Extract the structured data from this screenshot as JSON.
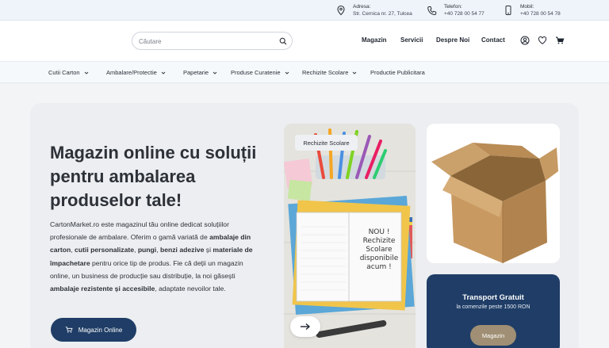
{
  "contact": [
    {
      "label": "Adresa:",
      "value": "Str. Cernica nr. 27, Tulcea",
      "icon": "location-pin-icon"
    },
    {
      "label": "Telefon:",
      "value": "+40 728 00 54 77",
      "icon": "phone-icon"
    },
    {
      "label": "Mobil:",
      "value": "+40 728 00 54 78",
      "icon": "mobile-icon"
    }
  ],
  "search": {
    "placeholder": "Căutare"
  },
  "nav": [
    "Magazin",
    "Servicii",
    "Despre Noi",
    "Contact"
  ],
  "header_icons": [
    "user-icon",
    "heart-icon",
    "cart-icon"
  ],
  "categories": [
    {
      "label": "Cutii Carton",
      "dropdown": true
    },
    {
      "label": "Ambalare/Protectie",
      "dropdown": true
    },
    {
      "label": "Papetarie",
      "dropdown": true
    },
    {
      "label": "Produse Curatenie",
      "dropdown": true
    },
    {
      "label": "Rechizite Scolare",
      "dropdown": true
    },
    {
      "label": "Productie Publicitara",
      "dropdown": false
    }
  ],
  "hero": {
    "title": "Magazin online cu soluții pentru ambalarea produselor tale!",
    "description": [
      {
        "t": "CartonMarket.ro este magazinul tău online dedicat soluțiilor profesionale de ambalare. Oferim o gamă variată de ",
        "b": false
      },
      {
        "t": "ambalaje din carton",
        "b": true
      },
      {
        "t": ", ",
        "b": false
      },
      {
        "t": "cutii personalizate",
        "b": true
      },
      {
        "t": ", ",
        "b": false
      },
      {
        "t": "pungi",
        "b": true
      },
      {
        "t": ", ",
        "b": false
      },
      {
        "t": "benzi adezive",
        "b": true
      },
      {
        "t": " și ",
        "b": false
      },
      {
        "t": "materiale de împachetare",
        "b": true
      },
      {
        "t": " pentru orice tip de produs. Fie că deții un magazin online, un business de producție sau distribuție, la noi găsești ",
        "b": false
      },
      {
        "t": "ambalaje rezistente și accesibile",
        "b": true
      },
      {
        "t": ", adaptate nevoilor tale.",
        "b": false
      }
    ],
    "cta_label": "Magazin Online"
  },
  "promo_image": {
    "tag": "Rechizite Scolare",
    "note_lines": [
      "NOU !",
      "Rechizite",
      "Scolare",
      "disponibile",
      "acum !"
    ]
  },
  "transport": {
    "title": "Transport Gratuit",
    "subtitle": "la comenzile peste 1500 RON",
    "button_label": "Magazin"
  },
  "colors": {
    "primary": "#1f3d66",
    "accent": "#a08f74",
    "topbar": "#eef4fa"
  }
}
